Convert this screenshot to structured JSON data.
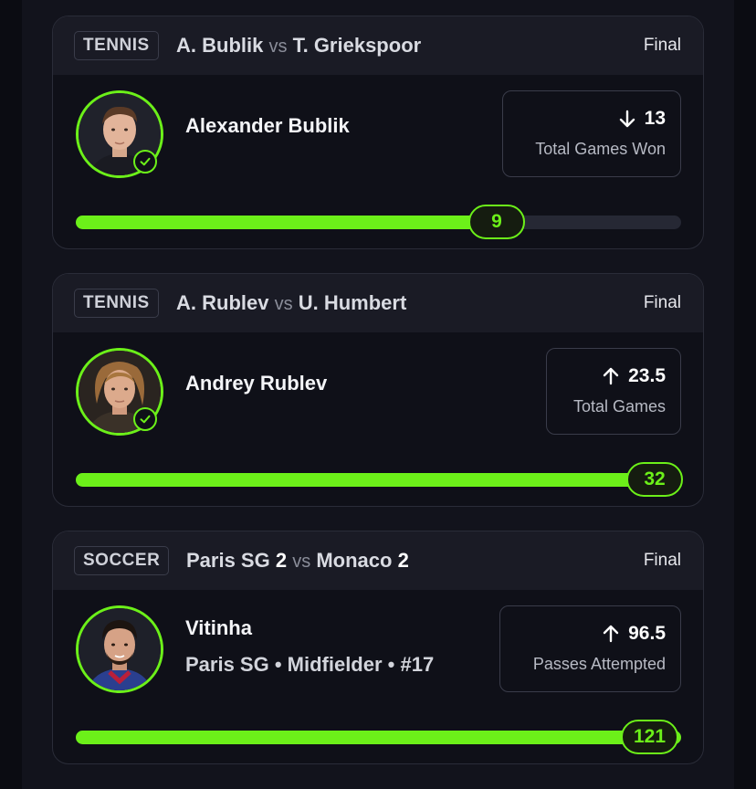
{
  "picks": [
    {
      "sport": "TENNIS",
      "team_a": "A. Bublik",
      "vs": "vs",
      "team_b": "T. Griekspoor",
      "score_a": "",
      "score_b": "",
      "status": "Final",
      "player": "Alexander Bublik",
      "player_sub": "",
      "direction": "down",
      "line": "13",
      "stat_label": "Total Games Won",
      "result": "9",
      "progress": 0.69,
      "hit": true
    },
    {
      "sport": "TENNIS",
      "team_a": "A. Rublev",
      "vs": "vs",
      "team_b": "U. Humbert",
      "score_a": "",
      "score_b": "",
      "status": "Final",
      "player": "Andrey Rublev",
      "player_sub": "",
      "direction": "up",
      "line": "23.5",
      "stat_label": "Total Games",
      "result": "32",
      "progress": 1.0,
      "hit": true
    },
    {
      "sport": "SOCCER",
      "team_a": "Paris SG",
      "vs": "vs",
      "team_b": "Monaco",
      "score_a": "2",
      "score_b": "2",
      "status": "Final",
      "player": "Vitinha",
      "player_sub": "Paris SG • Midfielder • #17",
      "direction": "up",
      "line": "96.5",
      "stat_label": "Passes Attempted",
      "result": "121",
      "progress": 1.0,
      "hit": false
    }
  ],
  "colors": {
    "accent": "#6cf019",
    "card_bg": "#0f1018",
    "header_bg": "#1a1b25",
    "page_bg": "#12131c"
  }
}
